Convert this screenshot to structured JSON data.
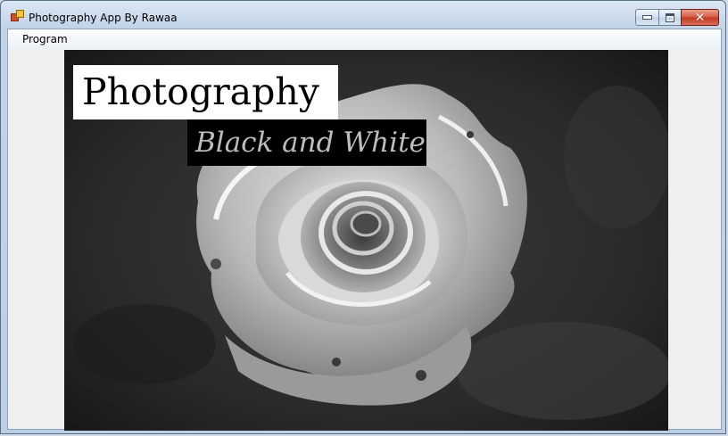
{
  "window": {
    "title": "Photography App By Rawaa",
    "icon": "app-icon",
    "controls": {
      "minimize": "minimize-icon",
      "maximize": "maximize-icon",
      "close": "close-icon",
      "close_glyph": "✕"
    }
  },
  "menu": {
    "items": [
      {
        "label": "Program"
      }
    ]
  },
  "picture": {
    "subject": "black-and-white rose photograph",
    "heading": "Photography",
    "subheading": "Black and White"
  },
  "colors": {
    "heading_bg": "#ffffff",
    "subheading_bg": "#000000",
    "subheading_text": "#bdbdbd",
    "close_button": "#c2371d"
  }
}
